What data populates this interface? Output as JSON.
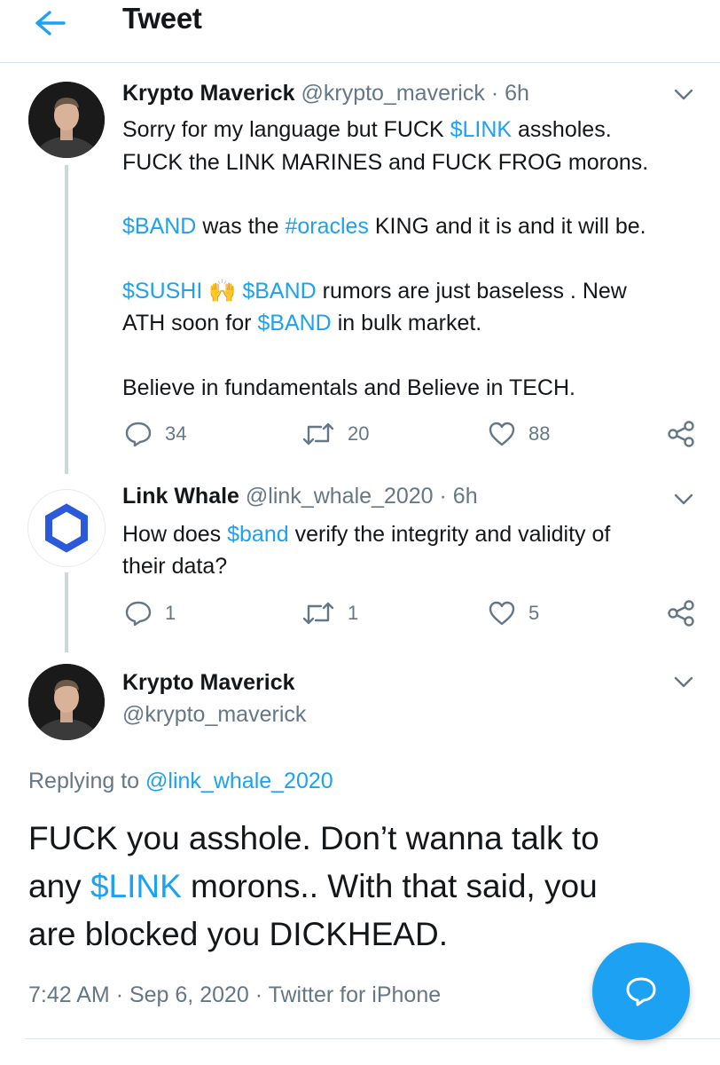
{
  "header": {
    "title": "Tweet"
  },
  "tweets": [
    {
      "display_name": "Krypto Maverick",
      "handle": "@krypto_maverick",
      "sep": "·",
      "time": "6h",
      "lines": [
        [
          "Sorry for my language but FUCK ",
          "$LINK",
          " assholes."
        ],
        [
          "FUCK the LINK MARINES and FUCK FROG morons."
        ],
        [
          "$BAND",
          " was the ",
          "#oracles",
          " KING and it is and it will be."
        ],
        [
          "$SUSHI",
          " 🙌 ",
          "$BAND",
          " rumors are just baseless . New"
        ],
        [
          "ATH soon for ",
          "$BAND",
          " in bulk market."
        ],
        [
          "Believe in fundamentals and Believe in TECH."
        ]
      ],
      "replies": "34",
      "retweets": "20",
      "likes": "88"
    },
    {
      "display_name": "Link Whale",
      "handle": "@link_whale_2020",
      "sep": "·",
      "time": "6h",
      "lines": [
        [
          "How does ",
          "$band",
          " verify the integrity and validity of"
        ],
        [
          "their data?"
        ]
      ],
      "replies": "1",
      "retweets": "1",
      "likes": "5"
    }
  ],
  "main_tweet": {
    "display_name": "Krypto Maverick",
    "handle": "@krypto_maverick",
    "replying_prefix": "Replying to ",
    "replying_to": "@link_whale_2020",
    "lines": [
      [
        "FUCK you asshole. Don’t wanna talk to"
      ],
      [
        "any ",
        "$LINK",
        " morons.. With that said, you"
      ],
      [
        "are blocked you DICKHEAD."
      ]
    ],
    "time": "7:42 AM",
    "sep1": "·",
    "date": "Sep 6, 2020",
    "sep2": "·",
    "source": "Twitter for iPhone"
  },
  "icons": {
    "back": "arrow-left-icon",
    "chevron": "chevron-down-icon",
    "reply": "comment-icon",
    "retweet": "retweet-icon",
    "like": "heart-icon",
    "share": "share-icon",
    "compose": "compose-reply-icon"
  },
  "colors": {
    "accent": "#1da1f2",
    "text": "#14171a",
    "muted": "#657786",
    "divider": "#e1e8ed"
  }
}
